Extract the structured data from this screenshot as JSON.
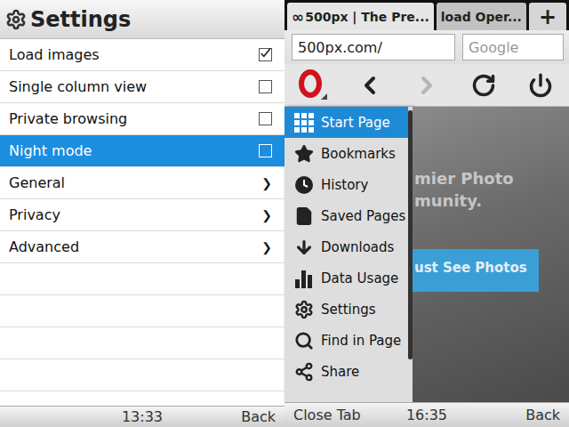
{
  "settings": {
    "title": "Settings",
    "rows": [
      {
        "label": "Load images",
        "kind": "checkbox",
        "checked": true,
        "selected": false
      },
      {
        "label": "Single column view",
        "kind": "checkbox",
        "checked": false,
        "selected": false
      },
      {
        "label": "Private browsing",
        "kind": "checkbox",
        "checked": false,
        "selected": false
      },
      {
        "label": "Night mode",
        "kind": "checkbox",
        "checked": false,
        "selected": true
      },
      {
        "label": "General",
        "kind": "link",
        "chevron": "❯",
        "selected": false
      },
      {
        "label": "Privacy",
        "kind": "link",
        "chevron": "❯",
        "selected": false
      },
      {
        "label": "Advanced",
        "kind": "link",
        "chevron": "❯",
        "selected": false
      }
    ]
  },
  "settings_status_bar": {
    "time": "13:33",
    "back": "Back"
  },
  "browser": {
    "tabs": [
      {
        "icon": "∞",
        "label": "500px | The Pre...",
        "selected": true
      },
      {
        "icon": "",
        "label": "load Oper...",
        "selected": false
      }
    ],
    "new_tab": "+",
    "address": "500px.com/",
    "search_placeholder": "Google",
    "nav": {
      "back_disabled": false,
      "forward_disabled": true
    }
  },
  "menu": {
    "items": [
      {
        "label": "Start Page",
        "selected": true
      },
      {
        "label": "Bookmarks",
        "selected": false
      },
      {
        "label": "History",
        "selected": false
      },
      {
        "label": "Saved Pages",
        "selected": false
      },
      {
        "label": "Downloads",
        "selected": false
      },
      {
        "label": "Data Usage",
        "selected": false
      },
      {
        "label": "Settings",
        "selected": false
      },
      {
        "label": "Find in Page",
        "selected": false
      },
      {
        "label": "Share",
        "selected": false
      }
    ]
  },
  "page": {
    "headline": [
      "mier Photo",
      "munity."
    ],
    "button": "ust See Photos"
  },
  "status_bar": {
    "left": "Close Tab",
    "time": "16:35",
    "back": "Back"
  }
}
